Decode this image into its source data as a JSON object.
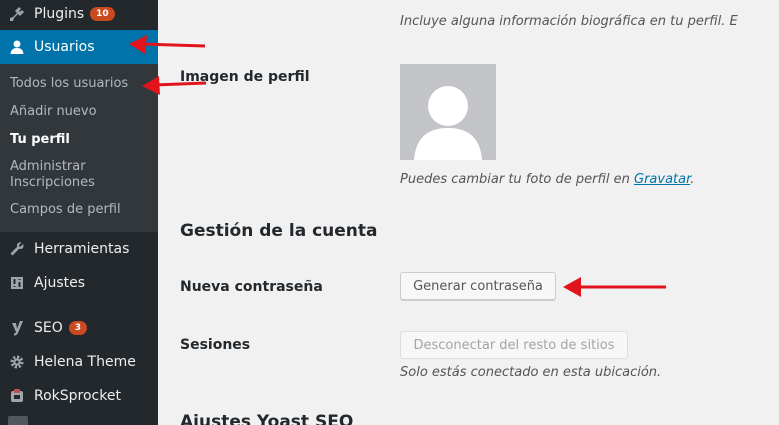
{
  "sidebar": {
    "items": [
      {
        "label": "Plugins",
        "icon": "plug-icon",
        "badge": "10"
      },
      {
        "label": "Usuarios",
        "icon": "user-icon"
      },
      {
        "label": "Herramientas",
        "icon": "wrench-icon"
      },
      {
        "label": "Ajustes",
        "icon": "settings-icon"
      },
      {
        "label": "SEO",
        "icon": "yoast-icon",
        "badge": "3"
      },
      {
        "label": "Helena Theme",
        "icon": "gear-icon"
      },
      {
        "label": "RokSprocket",
        "icon": "rocket-icon"
      }
    ],
    "submenu": [
      {
        "label": "Todos los usuarios"
      },
      {
        "label": "Añadir nuevo"
      },
      {
        "label": "Tu perfil"
      },
      {
        "label": "Administrar Inscripciones"
      },
      {
        "label": "Campos de perfil"
      }
    ]
  },
  "main": {
    "bio_description": "Incluye alguna información biográfica en tu perfil. E",
    "profile_image_label": "Imagen de perfil",
    "avatar_description_prefix": "Puedes cambiar tu foto de perfil en ",
    "avatar_description_link": "Gravatar",
    "avatar_description_suffix": ".",
    "account_section_title": "Gestión de la cuenta",
    "new_password_label": "Nueva contraseña",
    "generate_password_button": "Generar contraseña",
    "sessions_label": "Sesiones",
    "logout_everywhere_button": "Desconectar del resto de sitios",
    "sessions_description": "Solo estás conectado en esta ubicación.",
    "yoast_section_title": "Ajustes Yoast SEO"
  },
  "colors": {
    "sidebar_bg": "#23282d",
    "submenu_bg": "#32373c",
    "accent": "#0073aa",
    "badge": "#ca4a1f",
    "arrow": "#e2141b"
  }
}
